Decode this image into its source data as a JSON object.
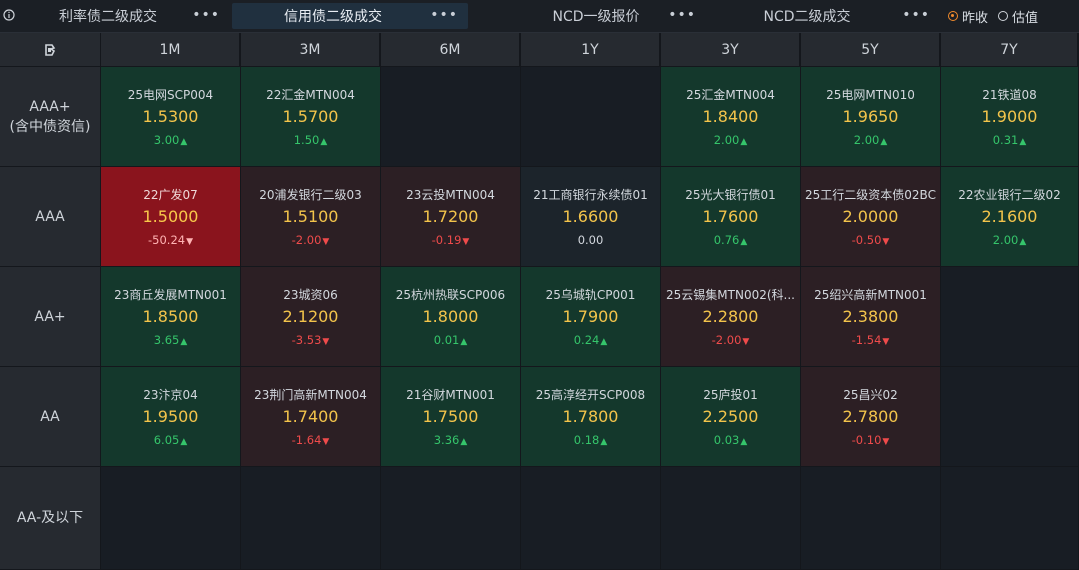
{
  "tabs": [
    {
      "label": "利率债二级成交",
      "active": false
    },
    {
      "label": "信用债二级成交",
      "active": true
    },
    {
      "label": "NCD一级报价",
      "active": false
    },
    {
      "label": "NCD二级成交",
      "active": false
    }
  ],
  "more_glyph": "•••",
  "radios": [
    {
      "label": "昨收",
      "checked": true
    },
    {
      "label": "估值",
      "checked": false
    }
  ],
  "columns": [
    "1M",
    "3M",
    "6M",
    "1Y",
    "3Y",
    "5Y",
    "7Y"
  ],
  "rows": [
    {
      "label_lines": [
        "AAA+",
        "(含中债资信)"
      ],
      "cells": [
        {
          "bond": "25电网SCP004",
          "yield": "1.5300",
          "change": "3.00",
          "dir": "up",
          "tone": "green"
        },
        {
          "bond": "22汇金MTN004",
          "yield": "1.5700",
          "change": "1.50",
          "dir": "up",
          "tone": "green"
        },
        null,
        null,
        {
          "bond": "25汇金MTN004",
          "yield": "1.8400",
          "change": "2.00",
          "dir": "up",
          "tone": "green"
        },
        {
          "bond": "25电网MTN010",
          "yield": "1.9650",
          "change": "2.00",
          "dir": "up",
          "tone": "green"
        },
        {
          "bond": "21铁道08",
          "yield": "1.9000",
          "change": "0.31",
          "dir": "up",
          "tone": "green"
        }
      ]
    },
    {
      "label_lines": [
        "AAA"
      ],
      "cells": [
        {
          "bond": "22广发07",
          "yield": "1.5000",
          "change": "-50.24",
          "dir": "down",
          "tone": "red"
        },
        {
          "bond": "20浦发银行二级03",
          "yield": "1.5100",
          "change": "-2.00",
          "dir": "down",
          "tone": "darkred"
        },
        {
          "bond": "23云投MTN004",
          "yield": "1.7200",
          "change": "-0.19",
          "dir": "down",
          "tone": "darkred"
        },
        {
          "bond": "21工商银行永续债01",
          "yield": "1.6600",
          "change": "0.00",
          "dir": "flat",
          "tone": "neutral"
        },
        {
          "bond": "25光大银行债01",
          "yield": "1.7600",
          "change": "0.76",
          "dir": "up",
          "tone": "green"
        },
        {
          "bond": "25工行二级资本债02BC",
          "yield": "2.0000",
          "change": "-0.50",
          "dir": "down",
          "tone": "darkred"
        },
        {
          "bond": "22农业银行二级02",
          "yield": "2.1600",
          "change": "2.00",
          "dir": "up",
          "tone": "green"
        }
      ]
    },
    {
      "label_lines": [
        "AA+"
      ],
      "cells": [
        {
          "bond": "23商丘发展MTN001",
          "yield": "1.8500",
          "change": "3.65",
          "dir": "up",
          "tone": "green"
        },
        {
          "bond": "23城资06",
          "yield": "2.1200",
          "change": "-3.53",
          "dir": "down",
          "tone": "darkred"
        },
        {
          "bond": "25杭州热联SCP006",
          "yield": "1.8000",
          "change": "0.01",
          "dir": "up",
          "tone": "green"
        },
        {
          "bond": "25乌城轨CP001",
          "yield": "1.7900",
          "change": "0.24",
          "dir": "up",
          "tone": "green"
        },
        {
          "bond": "25云锡集MTN002(科...",
          "yield": "2.2800",
          "change": "-2.00",
          "dir": "down",
          "tone": "darkred"
        },
        {
          "bond": "25绍兴高新MTN001",
          "yield": "2.3800",
          "change": "-1.54",
          "dir": "down",
          "tone": "darkred"
        },
        null
      ]
    },
    {
      "label_lines": [
        "AA"
      ],
      "cells": [
        {
          "bond": "23汴京04",
          "yield": "1.9500",
          "change": "6.05",
          "dir": "up",
          "tone": "green"
        },
        {
          "bond": "23荆门高新MTN004",
          "yield": "1.7400",
          "change": "-1.64",
          "dir": "down",
          "tone": "darkred"
        },
        {
          "bond": "21谷财MTN001",
          "yield": "1.7500",
          "change": "3.36",
          "dir": "up",
          "tone": "green"
        },
        {
          "bond": "25高淳经开SCP008",
          "yield": "1.7800",
          "change": "0.18",
          "dir": "up",
          "tone": "green"
        },
        {
          "bond": "25庐投01",
          "yield": "2.2500",
          "change": "0.03",
          "dir": "up",
          "tone": "green"
        },
        {
          "bond": "25昌兴02",
          "yield": "2.7800",
          "change": "-0.10",
          "dir": "down",
          "tone": "darkred"
        },
        null
      ]
    },
    {
      "label_lines": [
        "AA-及以下"
      ],
      "cells": [
        null,
        null,
        null,
        null,
        null,
        null,
        null
      ]
    }
  ],
  "icons": {
    "info": "info-circle-icon",
    "corner": "bond-logo-icon",
    "up": "arrow-up-icon",
    "down": "arrow-down-icon"
  }
}
